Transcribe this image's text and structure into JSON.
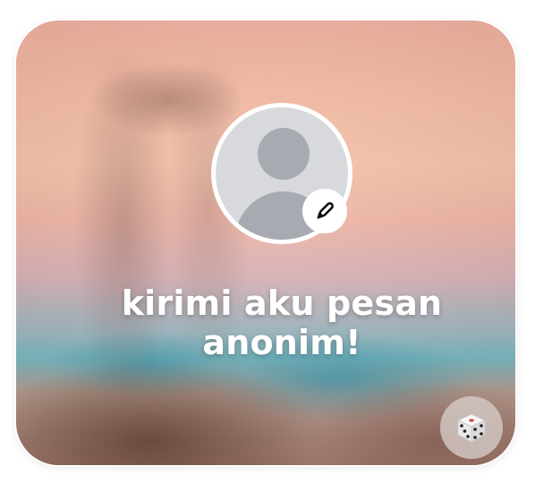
{
  "card": {
    "headline": "kirimi aku pesan anonim!"
  },
  "avatar": {
    "icon": "user-placeholder-icon",
    "edit_icon": "pencil-icon"
  },
  "dice": {
    "icon": "dice-icon"
  },
  "colors": {
    "avatar_bg": "#d7d9dc",
    "avatar_silhouette": "#a7abb1",
    "text": "#ffffff",
    "dice_red": "#e03a3a"
  }
}
